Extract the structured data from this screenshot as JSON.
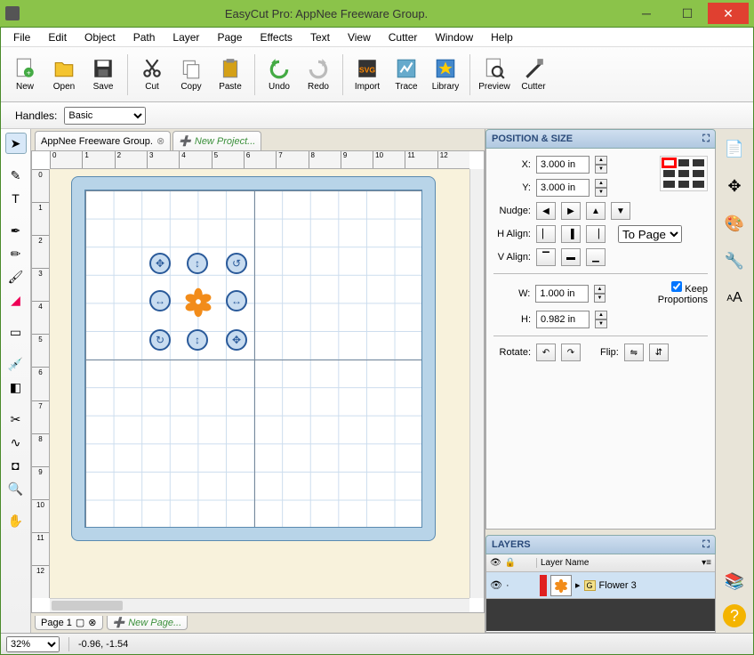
{
  "window": {
    "title": "EasyCut Pro: AppNee Freeware Group."
  },
  "menu": [
    "File",
    "Edit",
    "Object",
    "Path",
    "Layer",
    "Page",
    "Effects",
    "Text",
    "View",
    "Cutter",
    "Window",
    "Help"
  ],
  "toolbar": [
    {
      "label": "New",
      "icon": "new"
    },
    {
      "label": "Open",
      "icon": "open"
    },
    {
      "label": "Save",
      "icon": "save"
    },
    {
      "sep": true
    },
    {
      "label": "Cut",
      "icon": "cut"
    },
    {
      "label": "Copy",
      "icon": "copy"
    },
    {
      "label": "Paste",
      "icon": "paste"
    },
    {
      "sep": true
    },
    {
      "label": "Undo",
      "icon": "undo"
    },
    {
      "label": "Redo",
      "icon": "redo"
    },
    {
      "sep": true
    },
    {
      "label": "Import",
      "icon": "import"
    },
    {
      "label": "Trace",
      "icon": "trace"
    },
    {
      "label": "Library",
      "icon": "library"
    },
    {
      "sep": true
    },
    {
      "label": "Preview",
      "icon": "preview"
    },
    {
      "label": "Cutter",
      "icon": "cutter"
    }
  ],
  "handles": {
    "label": "Handles:",
    "value": "Basic"
  },
  "tabs": [
    {
      "label": "AppNee Freeware Group.",
      "closable": true
    },
    {
      "label": "New Project...",
      "new": true
    }
  ],
  "ruler_h": [
    "0",
    "1",
    "2",
    "3",
    "4",
    "5",
    "6",
    "7",
    "8",
    "9",
    "10",
    "11",
    "12"
  ],
  "ruler_v": [
    "0",
    "1",
    "2",
    "3",
    "4",
    "5",
    "6",
    "7",
    "8",
    "9",
    "10",
    "11",
    "12"
  ],
  "pages": [
    {
      "label": "Page 1"
    },
    {
      "label": "New Page...",
      "new": true
    }
  ],
  "position_size": {
    "title": "POSITION & SIZE",
    "x_label": "X:",
    "x": "3.000 in",
    "y_label": "Y:",
    "y": "3.000 in",
    "nudge_label": "Nudge:",
    "halign_label": "H Align:",
    "valign_label": "V Align:",
    "align_target": "To Page",
    "w_label": "W:",
    "w": "1.000 in",
    "h_label": "H:",
    "h": "0.982 in",
    "keep_prop": "Keep Proportions",
    "rotate_label": "Rotate:",
    "flip_label": "Flip:"
  },
  "layers": {
    "title": "LAYERS",
    "col_name": "Layer Name",
    "items": [
      {
        "name": "Flower 3",
        "group": "G"
      }
    ]
  },
  "status": {
    "zoom": "32%",
    "coords": "-0.96, -1.54"
  }
}
